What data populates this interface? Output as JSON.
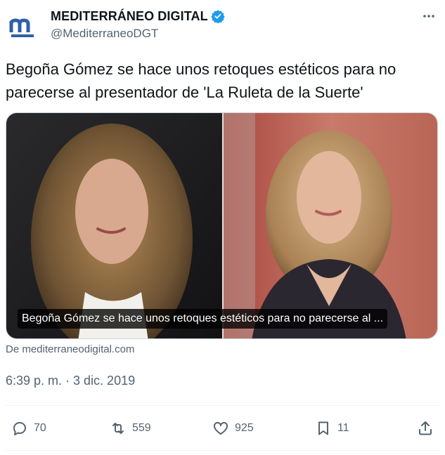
{
  "author": {
    "name": "MEDITERRÁNEO DIGITAL",
    "handle": "@MediterraneoDGT",
    "verified": true,
    "brand_color": "#2f5fa8",
    "verified_color": "#1d9bf0"
  },
  "tweet": {
    "text": "Begoña Gómez se hace unos retoques estéticos para no parecerse al presentador de 'La Ruleta de la Suerte'",
    "timestamp": "6:39 p. m. · 3 dic. 2019"
  },
  "card": {
    "caption": "Begoña Gómez se hace unos retoques estéticos para no parecerse al ...",
    "source": "De mediterraneodigital.com"
  },
  "actions": {
    "replies": "70",
    "retweets": "559",
    "likes": "925",
    "bookmarks": "11"
  },
  "icons": [
    "m-logo-icon",
    "verified-badge-icon",
    "more-icon",
    "reply-icon",
    "retweet-icon",
    "like-icon",
    "bookmark-icon",
    "share-icon"
  ]
}
